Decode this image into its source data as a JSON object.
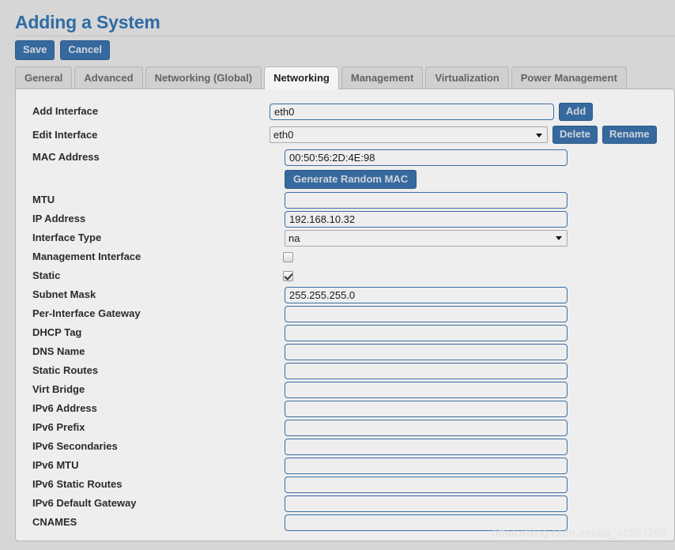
{
  "header": {
    "title": "Adding a System"
  },
  "toolbar": {
    "save_label": "Save",
    "cancel_label": "Cancel"
  },
  "tabs": [
    {
      "label": "General",
      "active": false
    },
    {
      "label": "Advanced",
      "active": false
    },
    {
      "label": "Networking (Global)",
      "active": false
    },
    {
      "label": "Networking",
      "active": true
    },
    {
      "label": "Management",
      "active": false
    },
    {
      "label": "Virtualization",
      "active": false
    },
    {
      "label": "Power Management",
      "active": false
    }
  ],
  "form": {
    "add_interface": {
      "label": "Add Interface",
      "value": "eth0",
      "placeholder": "",
      "button": "Add"
    },
    "edit_interface": {
      "label": "Edit Interface",
      "value": "eth0",
      "options": [
        "eth0"
      ],
      "delete_button": "Delete",
      "rename_button": "Rename"
    },
    "mac_address": {
      "label": "MAC Address",
      "value": "00:50:56:2D:4E:98",
      "placeholder": "",
      "generate_button": "Generate Random MAC"
    },
    "mtu": {
      "label": "MTU",
      "value": "",
      "placeholder": ""
    },
    "ip_address": {
      "label": "IP Address",
      "value": "192.168.10.32",
      "placeholder": ""
    },
    "interface_type": {
      "label": "Interface Type",
      "value": "na",
      "options": [
        "na"
      ]
    },
    "management_interface": {
      "label": "Management Interface",
      "checked": false
    },
    "static": {
      "label": "Static",
      "checked": true
    },
    "subnet_mask": {
      "label": "Subnet Mask",
      "value": "255.255.255.0",
      "placeholder": ""
    },
    "per_interface_gateway": {
      "label": "Per-Interface Gateway",
      "value": "",
      "placeholder": ""
    },
    "dhcp_tag": {
      "label": "DHCP Tag",
      "value": "",
      "placeholder": ""
    },
    "dns_name": {
      "label": "DNS Name",
      "value": "",
      "placeholder": ""
    },
    "static_routes": {
      "label": "Static Routes",
      "value": "",
      "placeholder": ""
    },
    "virt_bridge": {
      "label": "Virt Bridge",
      "value": "",
      "placeholder": ""
    },
    "ipv6_address": {
      "label": "IPv6 Address",
      "value": "",
      "placeholder": ""
    },
    "ipv6_prefix": {
      "label": "IPv6 Prefix",
      "value": "",
      "placeholder": ""
    },
    "ipv6_secondaries": {
      "label": "IPv6 Secondaries",
      "value": "",
      "placeholder": ""
    },
    "ipv6_mtu": {
      "label": "IPv6 MTU",
      "value": "",
      "placeholder": ""
    },
    "ipv6_static_routes": {
      "label": "IPv6 Static Routes",
      "value": "",
      "placeholder": ""
    },
    "ipv6_default_gateway": {
      "label": "IPv6 Default Gateway",
      "value": "",
      "placeholder": ""
    },
    "cnames": {
      "label": "CNAMES",
      "value": "",
      "placeholder": ""
    }
  },
  "watermark": {
    "text": "https://blog.csdn.net/qq_42527269"
  },
  "colors": {
    "title": "#2e6ca4",
    "button": "#36699e",
    "button_text": "#d3d7dc",
    "panel_bg": "#eeeeee",
    "page_bg": "#d6d6d6",
    "tab_inactive": "#d0d0d0",
    "tab_active": "#f4f4f4",
    "input_border": "#3a6ea5"
  }
}
